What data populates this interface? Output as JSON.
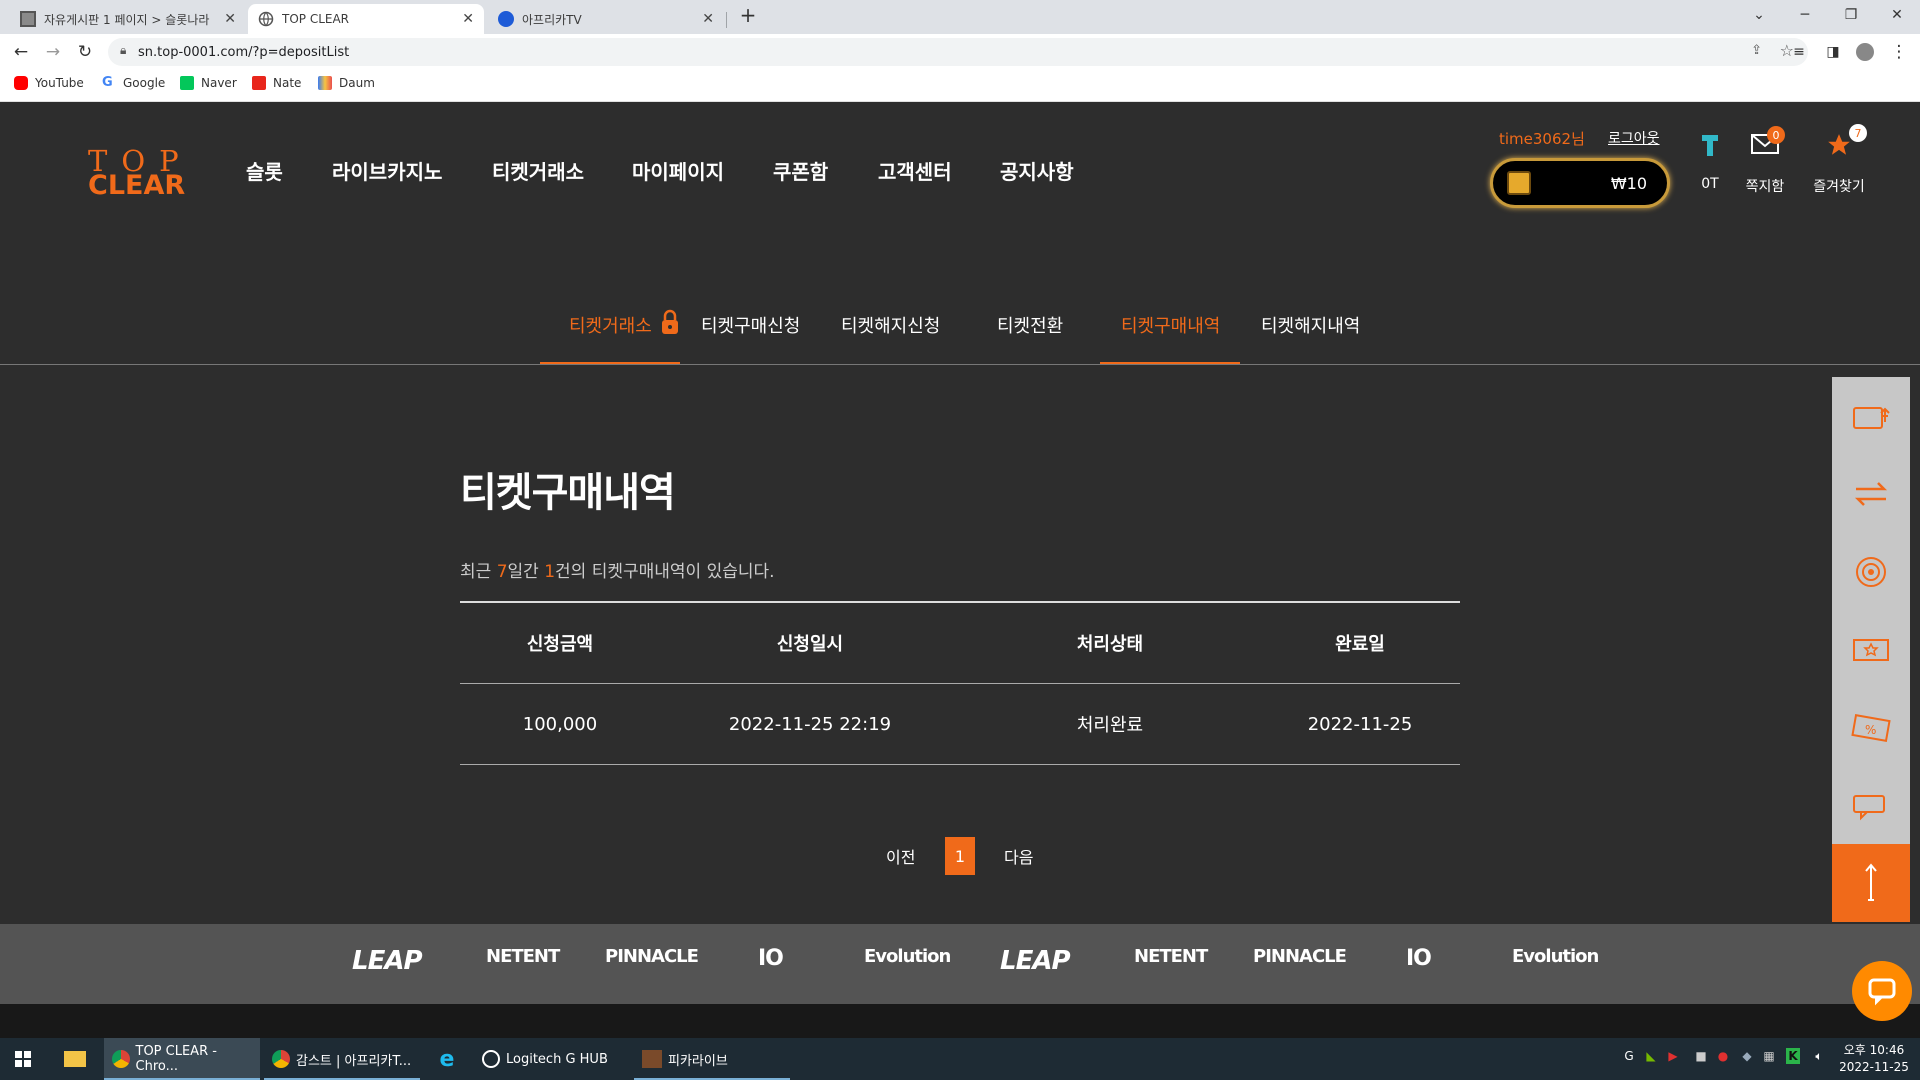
{
  "browser": {
    "tabs": [
      {
        "title": "자유게시판 1 페이지 > 슬롯나라"
      },
      {
        "title": "TOP CLEAR"
      },
      {
        "title": "아프리카TV"
      }
    ],
    "url": "sn.top-0001.com/?p=depositList",
    "bookmarks": [
      "YouTube",
      "Google",
      "Naver",
      "Nate",
      "Daum"
    ]
  },
  "site": {
    "logo_top": "TOP",
    "logo_bottom": "CLEAR",
    "nav": [
      "슬롯",
      "라이브카지노",
      "티켓거래소",
      "마이페이지",
      "쿠폰함",
      "고객센터",
      "공지사항"
    ],
    "user": {
      "name": "time3062님",
      "logout": "로그아웃",
      "balance": "₩10",
      "ticket_label": "0T",
      "messages_label": "쪽지함",
      "messages_count": "0",
      "favorites_label": "즐겨찾기",
      "favorites_count": "7"
    },
    "subnav": [
      "티켓거래소",
      "티켓구매신청",
      "티켓해지신청",
      "티켓전환",
      "티켓구매내역",
      "티켓해지내역"
    ],
    "page_title": "티켓구매내역",
    "summary": {
      "pre": "최근 ",
      "days": "7",
      "mid": "일간 ",
      "count": "1",
      "post": "건의 티켓구매내역이 있습니다."
    },
    "table": {
      "headers": [
        "신청금액",
        "신청일시",
        "처리상태",
        "완료일"
      ],
      "rows": [
        [
          "100,000",
          "2022-11-25 22:19",
          "처리완료",
          "2022-11-25"
        ]
      ]
    },
    "pager": {
      "prev": "이전",
      "current": "1",
      "next": "다음"
    },
    "providers": [
      "LEAP",
      "NETENT",
      "PINNACLE",
      "IO",
      "Evolution",
      "LEAP",
      "NETENT",
      "PINNACLE",
      "IO",
      "Evolution"
    ],
    "accent": "#f06a1a"
  },
  "taskbar": {
    "apps": [
      "TOP CLEAR - Chro...",
      "감스트 | 아프리카T...",
      "Logitech G HUB",
      "피카라이브"
    ],
    "time": "오후 10:46",
    "date": "2022-11-25"
  }
}
